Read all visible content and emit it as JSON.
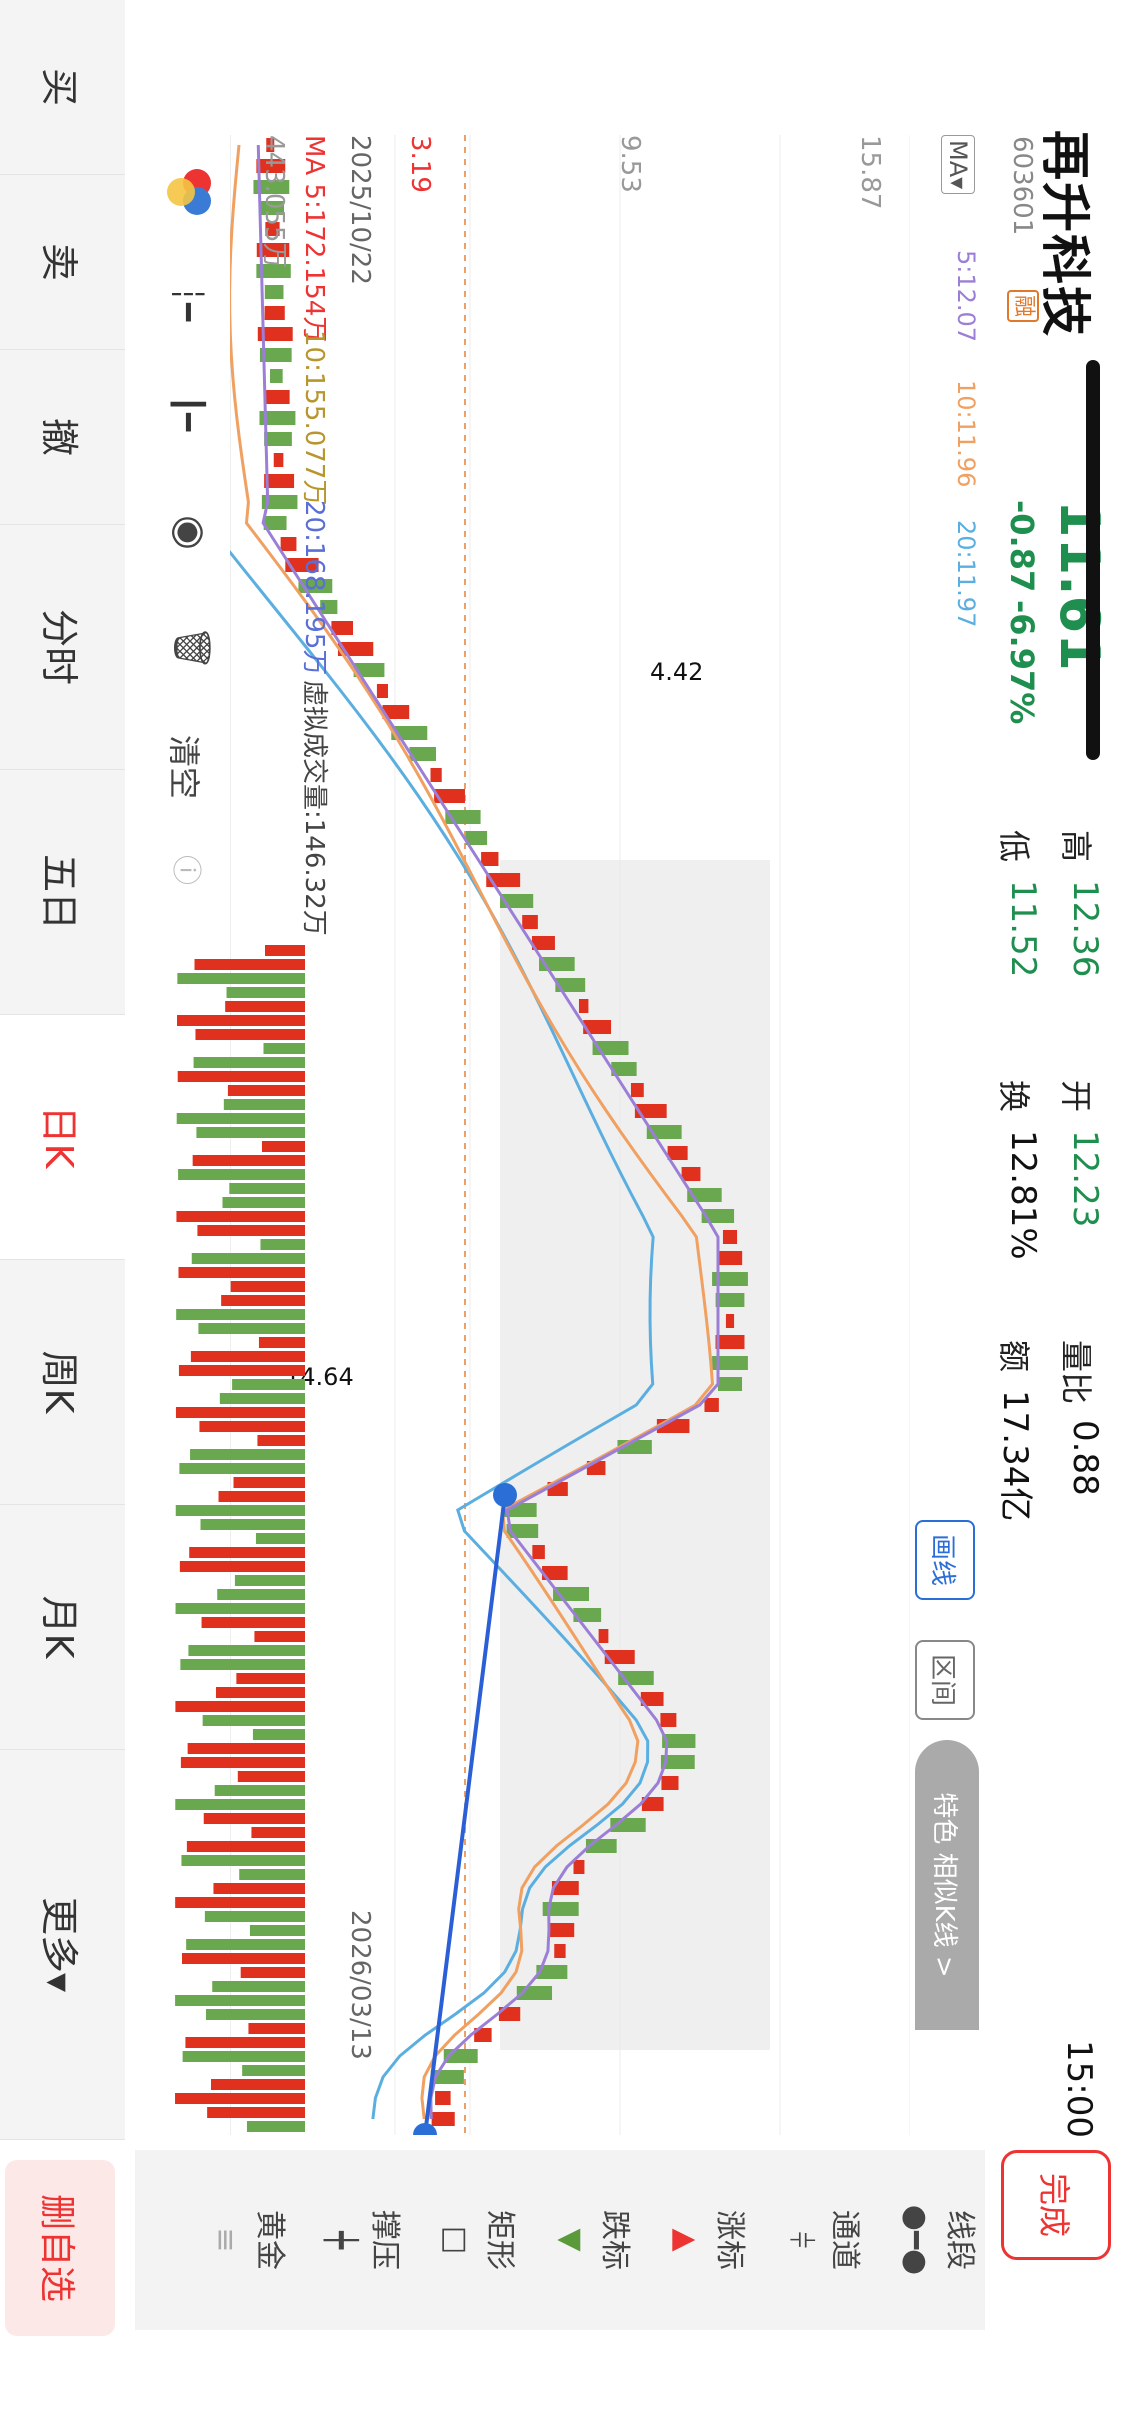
{
  "header": {
    "stock_name": "再升科技",
    "stock_code": "603601",
    "margin_tag": "融",
    "price": "11.61",
    "change": "-0.87",
    "change_pct": "-6.97%",
    "high_label": "高",
    "high_value": "12.36",
    "low_label": "低",
    "low_value": "11.52",
    "open_label": "开",
    "open_value": "12.23",
    "turnover_label": "换",
    "turnover_value": "12.81%",
    "vol_ratio_label": "量比",
    "vol_ratio_value": "0.88",
    "amount_label": "额",
    "amount_value": "17.34亿",
    "time": "15:00",
    "done_button": "完成"
  },
  "chart": {
    "ma_selector": "MA▾",
    "ma5": "5:12.07",
    "ma10": "10:11.96",
    "ma20": "20:11.97",
    "y_top": "15.87",
    "y_mid": "9.53",
    "y_bottom": "3.19",
    "start_date": "2025/10/22",
    "end_date": "2026/03/13",
    "high_mark": "14.64",
    "low_mark": "4.42",
    "draw_line_tab": "画线",
    "range_tab": "区间",
    "feature_label": "特色 相似K线 >",
    "colors": {
      "up": "#e0301e",
      "down": "#6aa84f",
      "ma5": "#9b7fd6",
      "ma10": "#f0a060",
      "ma20": "#5aaee0",
      "trend": "#2b5fd6"
    }
  },
  "volume": {
    "ma5": "MA 5:172.154万",
    "ma10": "10:155.077万",
    "ma20": "20:168.195万",
    "virtual": "虚拟成交量:146.32万",
    "current": "443.055万"
  },
  "chart_controls": {
    "clear_label": "清空"
  },
  "tools": [
    "线段",
    "通道",
    "涨标",
    "跌标",
    "矩形",
    "撑压",
    "黄金"
  ],
  "delete_watch": "删自选",
  "nav": [
    "买",
    "卖",
    "撤",
    "分时",
    "五日",
    "日K",
    "周K",
    "月K",
    "更多▾"
  ],
  "nav_active": "日K"
}
